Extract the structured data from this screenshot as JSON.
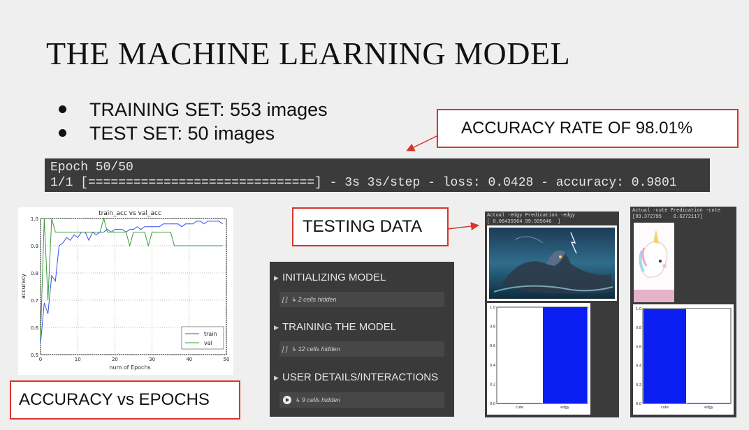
{
  "slide": {
    "title": "THE MACHINE LEARNING MODEL",
    "bullets": [
      {
        "text": "TRAINING SET: 553 images"
      },
      {
        "text": "TEST SET: 50 images"
      }
    ],
    "callouts": {
      "accuracy_rate": "ACCURACY RATE OF 98.01%",
      "testing_data": "TESTING DATA",
      "accuracy_vs_epochs": "ACCURACY vs EPOCHS"
    },
    "colors": {
      "callout_border": "#d9342b",
      "train": "#3b4cf0",
      "val": "#3a9a3a",
      "bar": "#0a1ef2"
    }
  },
  "terminal": {
    "line1": "Epoch 50/50",
    "line2": "1/1 [==============================] - 3s 3s/step - loss: 0.0428 - accuracy: 0.9801"
  },
  "notebook": {
    "sections": [
      {
        "title": "INITIALIZING MODEL",
        "hidden": "↳ 2 cells hidden",
        "prefix": "[ ]"
      },
      {
        "title": "TRAINING THE MODEL",
        "hidden": "↳ 12 cells hidden",
        "prefix": "[ ]"
      },
      {
        "title": "USER DETAILS/INTERACTIONS",
        "hidden": "↳ 9 cells hidden",
        "prefix": "play"
      }
    ]
  },
  "predictions": [
    {
      "header1": "Actual -edgy Predication -edgy",
      "header2": "[ 0.06435964 99.935646  ]",
      "image_icon": "dragon-image",
      "chart_data": {
        "type": "bar",
        "categories": [
          "cute",
          "edgy"
        ],
        "values": [
          0.06435964,
          99.935646
        ],
        "yticks": [
          "0.0",
          "0.2",
          "0.4",
          "0.6",
          "0.8",
          "1.0"
        ]
      }
    },
    {
      "header1": "Actual -cute Predication -cute",
      "header2": "[99.372795    0.6272117]",
      "image_icon": "unicorn-image",
      "chart_data": {
        "type": "bar",
        "categories": [
          "cute",
          "edgy"
        ],
        "values": [
          99.372795,
          0.6272117
        ],
        "yticks": [
          "0.0",
          "0.2",
          "0.4",
          "0.6",
          "0.8",
          "1.0"
        ]
      }
    }
  ],
  "chart_data": {
    "type": "line",
    "title": "train_acc vs val_acc",
    "xlabel": "num of Epochs",
    "ylabel": "accuracy",
    "xlim": [
      0,
      50
    ],
    "ylim": [
      0.5,
      1.0
    ],
    "xticks": [
      "0",
      "10",
      "20",
      "30",
      "40",
      "50"
    ],
    "yticks": [
      "0.5",
      "0.6",
      "0.7",
      "0.8",
      "0.9",
      "1.0"
    ],
    "grid": true,
    "legend_position": "bottom-right",
    "series": [
      {
        "name": "train",
        "color": "#3b4cf0",
        "x": [
          0,
          1,
          2,
          3,
          4,
          5,
          6,
          7,
          8,
          9,
          10,
          11,
          12,
          13,
          14,
          15,
          16,
          17,
          18,
          19,
          20,
          21,
          22,
          23,
          24,
          25,
          26,
          27,
          28,
          29,
          30,
          31,
          32,
          33,
          34,
          35,
          36,
          37,
          38,
          39,
          40,
          41,
          42,
          43,
          44,
          45,
          46,
          47,
          48,
          49
        ],
        "values": [
          0.54,
          0.69,
          0.65,
          0.79,
          0.77,
          0.9,
          0.91,
          0.93,
          0.92,
          0.94,
          0.93,
          0.95,
          0.95,
          0.92,
          0.95,
          0.94,
          0.95,
          0.95,
          0.96,
          0.95,
          0.96,
          0.96,
          0.96,
          0.95,
          0.96,
          0.96,
          0.97,
          0.96,
          0.97,
          0.97,
          0.97,
          0.97,
          0.97,
          0.98,
          0.98,
          0.98,
          0.98,
          0.98,
          0.97,
          0.98,
          0.98,
          0.98,
          0.99,
          0.99,
          0.98,
          0.99,
          0.99,
          0.99,
          0.99,
          0.98
        ]
      },
      {
        "name": "val",
        "color": "#3a9a3a",
        "x": [
          0,
          1,
          2,
          3,
          4,
          5,
          6,
          7,
          8,
          9,
          10,
          11,
          12,
          13,
          14,
          15,
          16,
          17,
          18,
          19,
          20,
          21,
          22,
          23,
          24,
          25,
          26,
          27,
          28,
          29,
          30,
          31,
          32,
          33,
          34,
          35,
          36,
          37,
          38,
          39,
          40,
          41,
          42,
          43,
          44,
          45,
          46,
          47,
          48,
          49
        ],
        "values": [
          0.56,
          1.0,
          0.7,
          1.0,
          0.95,
          0.95,
          0.95,
          0.95,
          0.95,
          0.95,
          0.95,
          0.95,
          0.95,
          0.95,
          0.95,
          0.95,
          0.95,
          1.0,
          0.95,
          0.95,
          0.95,
          0.95,
          0.95,
          0.95,
          0.9,
          0.95,
          0.95,
          0.95,
          0.95,
          0.9,
          0.95,
          0.95,
          0.95,
          0.95,
          0.95,
          0.95,
          0.9,
          0.9,
          0.9,
          0.9,
          0.9,
          0.9,
          0.9,
          0.9,
          0.9,
          0.9,
          0.9,
          0.9,
          0.9,
          0.9
        ]
      }
    ]
  }
}
